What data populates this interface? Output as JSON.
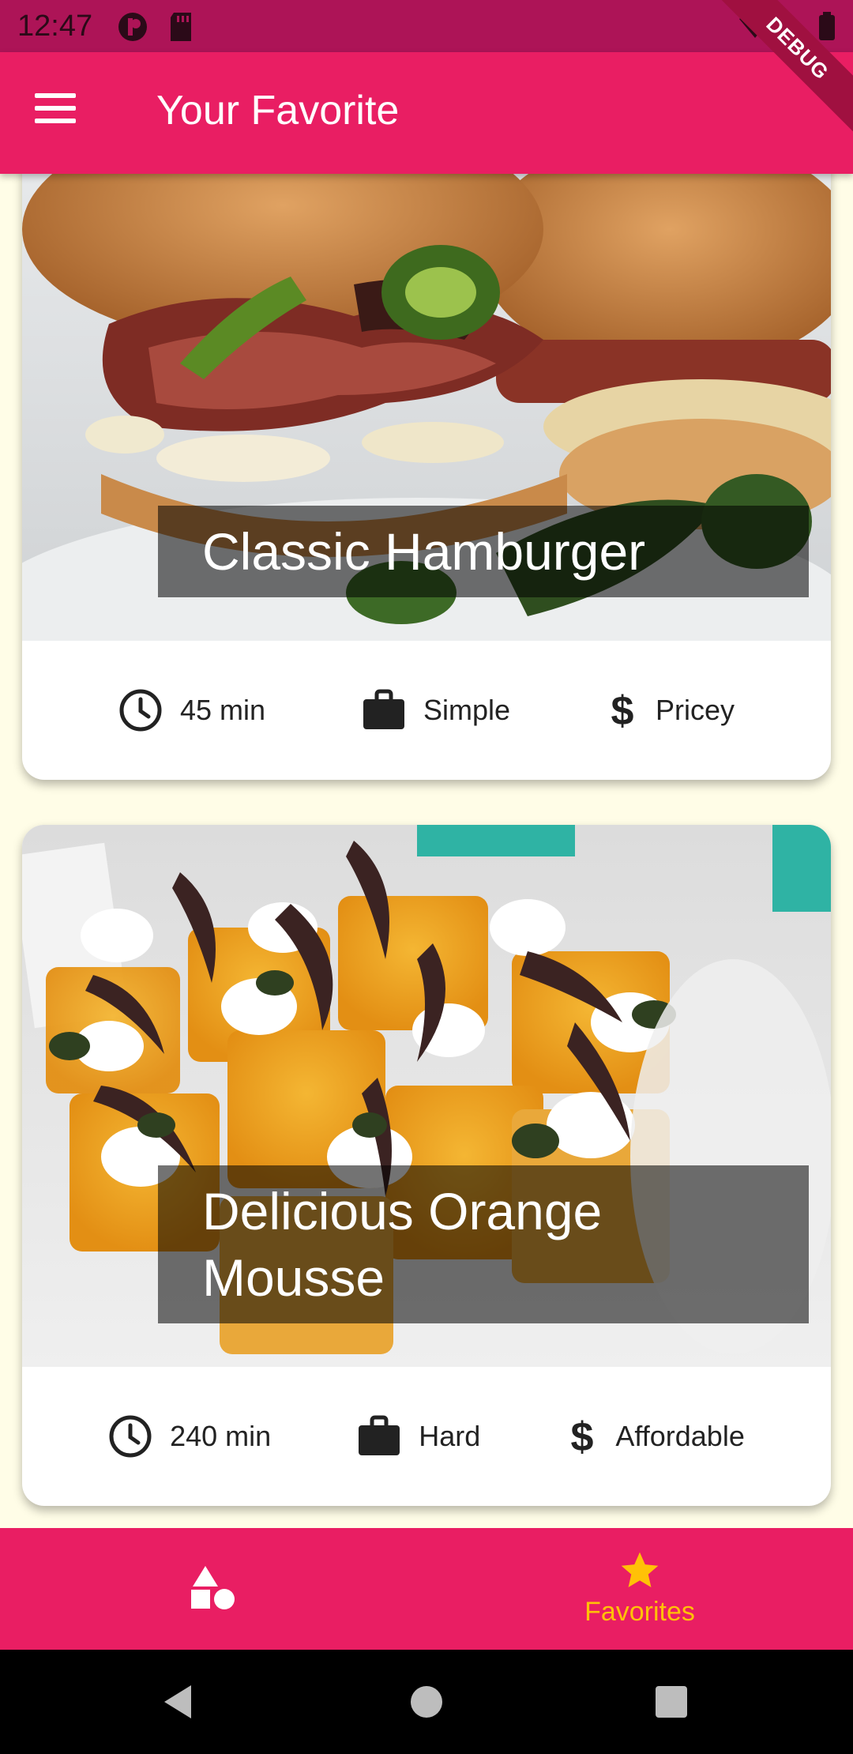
{
  "status_bar": {
    "time": "12:47"
  },
  "debug_banner": "DEBUG",
  "app_bar": {
    "title": "Your Favorite"
  },
  "meals": [
    {
      "title": "Classic Hamburger",
      "duration": "45 min",
      "complexity": "Simple",
      "affordability": "Pricey"
    },
    {
      "title": "Delicious Orange Mousse",
      "duration": "240 min",
      "complexity": "Hard",
      "affordability": "Affordable"
    }
  ],
  "bottom_nav": {
    "tabs": [
      {
        "label": "",
        "icon": "categories-icon",
        "selected": false
      },
      {
        "label": "Favorites",
        "icon": "star-icon",
        "selected": true
      }
    ]
  },
  "colors": {
    "primary": "#e91e63",
    "accent": "#ffc107",
    "status": "#ad1457",
    "background": "#fffde7"
  }
}
